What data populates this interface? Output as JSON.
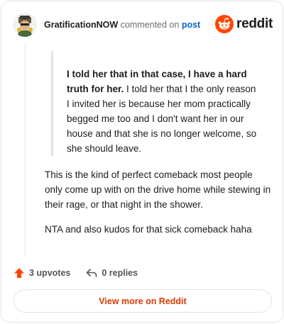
{
  "header": {
    "author": "GratificationNOW",
    "action_text": "commented on",
    "link_text": "post",
    "brand": "reddit"
  },
  "quote": {
    "bold": "I told her that in that case, I have a hard truth for her.",
    "rest": " I told her that I the only reason I invited her is because her mom practically begged me too and I don't want her in our house and that she is no longer welcome, so she should leave."
  },
  "body": {
    "paragraph1": "This is the kind of perfect comeback most people only come up with on the drive home while stewing in their rage, or that night in the shower.",
    "paragraph2": "NTA and also kudos for that sick comeback haha"
  },
  "actions": {
    "upvotes": "3 upvotes",
    "replies": "0 replies"
  },
  "view_more": "View more on Reddit",
  "colors": {
    "reddit_orange": "#ff4500",
    "link_blue": "#0a64c8",
    "cta_text": "#d93a00"
  }
}
